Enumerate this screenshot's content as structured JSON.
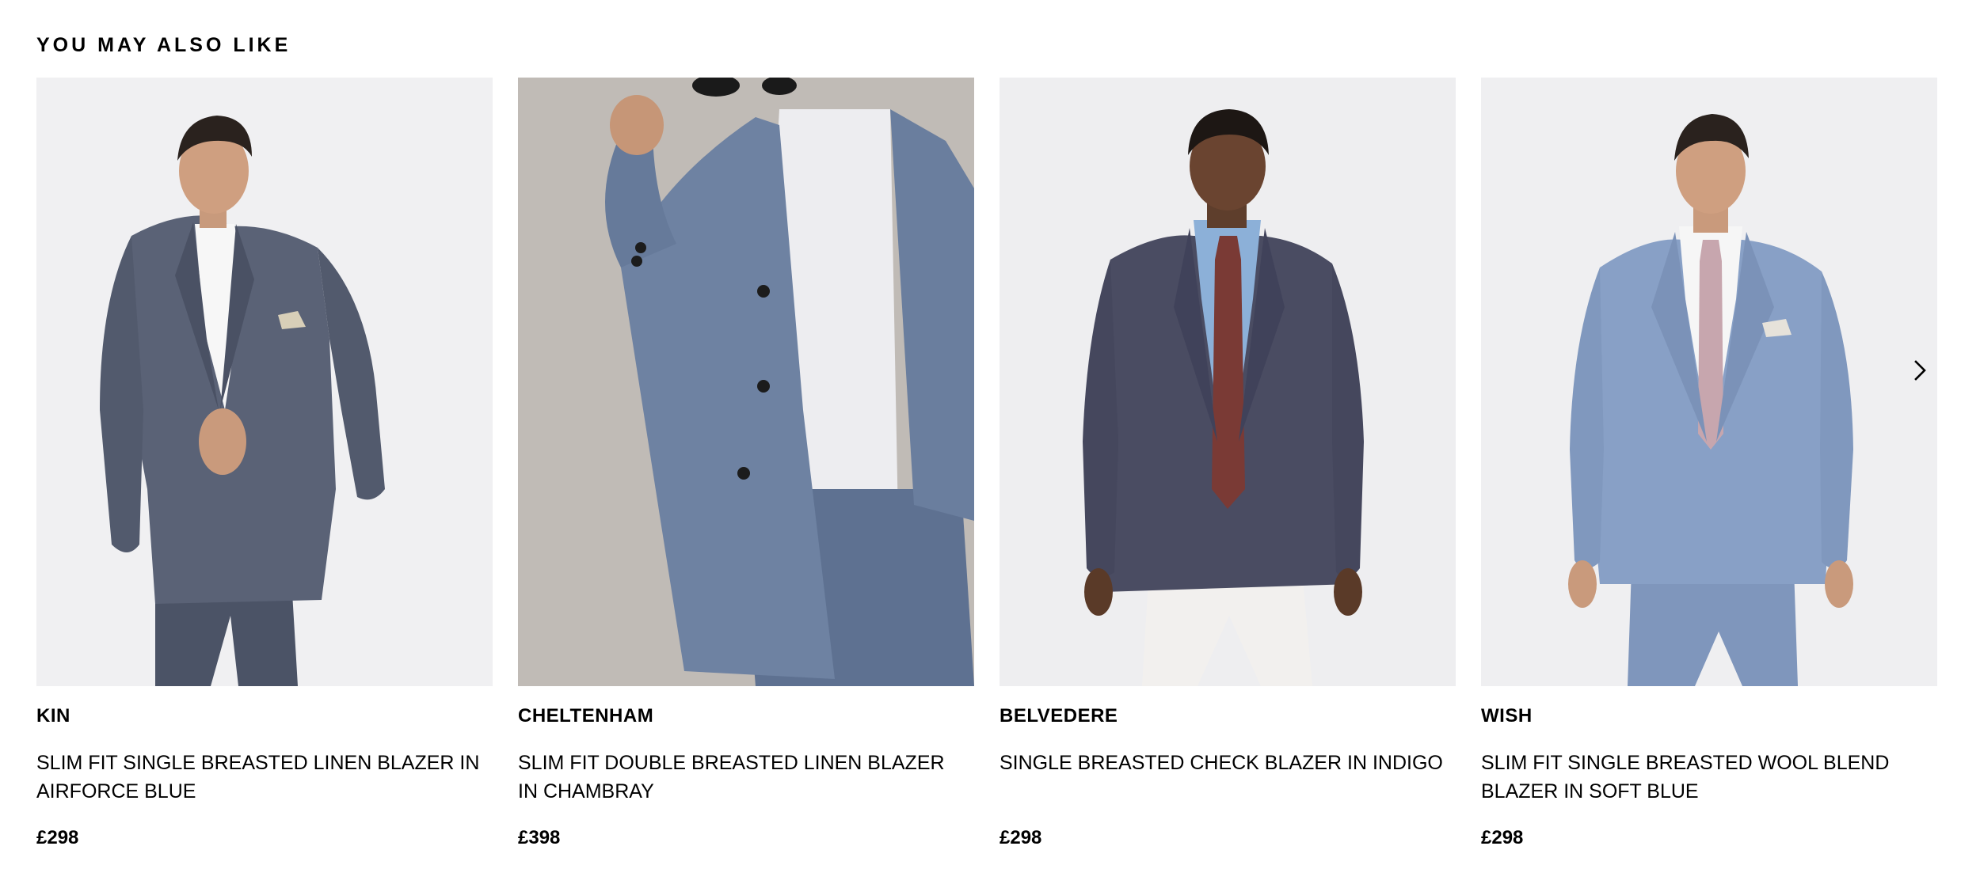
{
  "section": {
    "title": "YOU MAY ALSO LIKE"
  },
  "products": [
    {
      "brand": "KIN",
      "description": "SLIM FIT SINGLE BREASTED LINEN BLAZER IN AIRFORCE BLUE",
      "price": "£298",
      "image_alt": "Man in slim fit single breasted linen blazer in airforce blue"
    },
    {
      "brand": "CHELTENHAM",
      "description": "SLIM FIT DOUBLE BREASTED LINEN BLAZER IN CHAMBRAY",
      "price": "£398",
      "image_alt": "Man in slim fit double breasted linen blazer in chambray"
    },
    {
      "brand": "BELVEDERE",
      "description": "SINGLE BREASTED CHECK BLAZER IN INDIGO",
      "price": "£298",
      "image_alt": "Man in single breasted check blazer in indigo"
    },
    {
      "brand": "WISH",
      "description": "SLIM FIT SINGLE BREASTED WOOL BLEND BLAZER IN SOFT BLUE",
      "price": "£298",
      "image_alt": "Man in slim fit single breasted wool blend blazer in soft blue"
    }
  ],
  "carousel": {
    "next_icon": "chevron-right-icon"
  },
  "colors": {
    "text": "#000000",
    "background": "#ffffff",
    "image_background": "#efeff1"
  }
}
